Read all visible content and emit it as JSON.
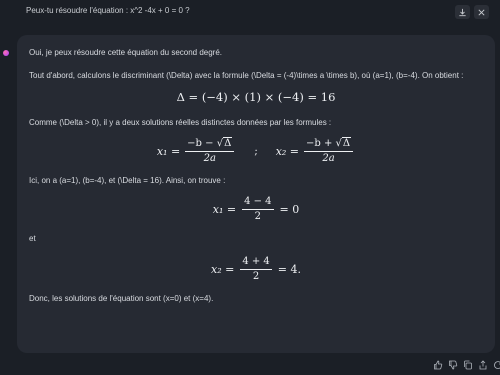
{
  "prompt": {
    "text": "Peux-tu résoudre l'équation : x^2 -4x + 0 = 0 ?"
  },
  "answer": {
    "intro": "Oui, je peux résoudre cette équation du second degré.",
    "discriminant_text": "Tout d'abord, calculons le discriminant (\\Delta) avec la formule (\\Delta = (-4)\\times a \\times b), où (a=1), (b=-4). On obtient :",
    "delta_eq": "Δ = (−4) × (1) × (−4) = 16",
    "solutions_text": "Comme (\\Delta > 0), il y a deux solutions réelles distinctes données par les formules :",
    "formula_x1_lhs": "x₁ =",
    "formula_x1_num_prefix": "−b −",
    "formula_x1_rad": "Δ",
    "formula_x1_den": "2a",
    "formula_sep": ";",
    "formula_x2_lhs": "x₂ =",
    "formula_x2_num_prefix": "−b +",
    "formula_x2_rad": "Δ",
    "formula_x2_den": "2a",
    "values_text": "Ici, on a (a=1), (b=-4), et (\\Delta = 16). Ainsi, on trouve :",
    "x1_lhs": "x₁ =",
    "x1_num": "4 − 4",
    "x1_den": "2",
    "x1_rhs": "= 0",
    "et": "et",
    "x2_lhs": "x₂ =",
    "x2_num": "4 + 4",
    "x2_den": "2",
    "x2_rhs": "= 4.",
    "conclusion": "Donc, les solutions de l'équation sont (x=0) et (x=4)."
  },
  "icons": {
    "top": [
      "download-icon",
      "close-icon"
    ],
    "footer": [
      "thumbs-up-icon",
      "thumbs-down-icon",
      "copy-icon",
      "share-icon",
      "regenerate-icon"
    ]
  },
  "colors": {
    "background": "#1b1f26",
    "card": "#262a33",
    "text": "#d8dbe0",
    "avatar_gradient": [
      "#ff6fb0",
      "#a53cff"
    ]
  }
}
